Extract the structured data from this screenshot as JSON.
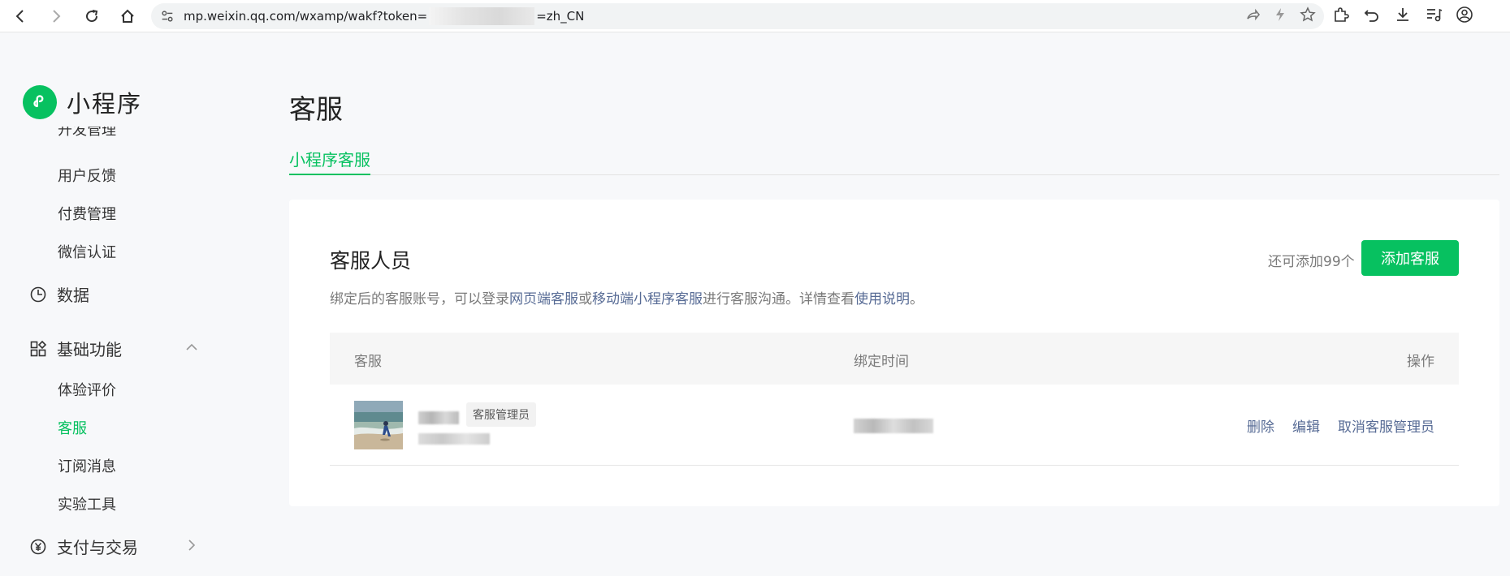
{
  "browser": {
    "url_prefix": "mp.weixin.qq.com/wxamp/wakf?token=",
    "url_suffix": "=zh_CN"
  },
  "sidebar": {
    "logo_text": "小程序",
    "clipped_item": "开发管理",
    "items_top": [
      {
        "label": "用户反馈"
      },
      {
        "label": "付费管理"
      },
      {
        "label": "微信认证"
      }
    ],
    "group_data": "数据",
    "group_basic": "基础功能",
    "items_basic": [
      {
        "label": "体验评价"
      },
      {
        "label": "客服"
      },
      {
        "label": "订阅消息"
      },
      {
        "label": "实验工具"
      }
    ],
    "group_pay": "支付与交易"
  },
  "main": {
    "page_title": "客服",
    "tab_label": "小程序客服",
    "card": {
      "title": "客服人员",
      "desc_1": "绑定后的客服账号，可以登录",
      "desc_link_1": "网页端客服",
      "desc_2": "或",
      "desc_link_2": "移动端小程序客服",
      "desc_3": "进行客服沟通。详情查看",
      "desc_link_3": "使用说明",
      "desc_4": "。",
      "remain_text": "还可添加99个",
      "add_button": "添加客服"
    },
    "table": {
      "col_service": "客服",
      "col_time": "绑定时间",
      "col_ops": "操作",
      "rows": [
        {
          "badge": "客服管理员",
          "op_delete": "删除",
          "op_edit": "编辑",
          "op_cancel": "取消客服管理员"
        }
      ]
    }
  },
  "colors": {
    "accent": "#07c160",
    "link": "#576b95"
  }
}
